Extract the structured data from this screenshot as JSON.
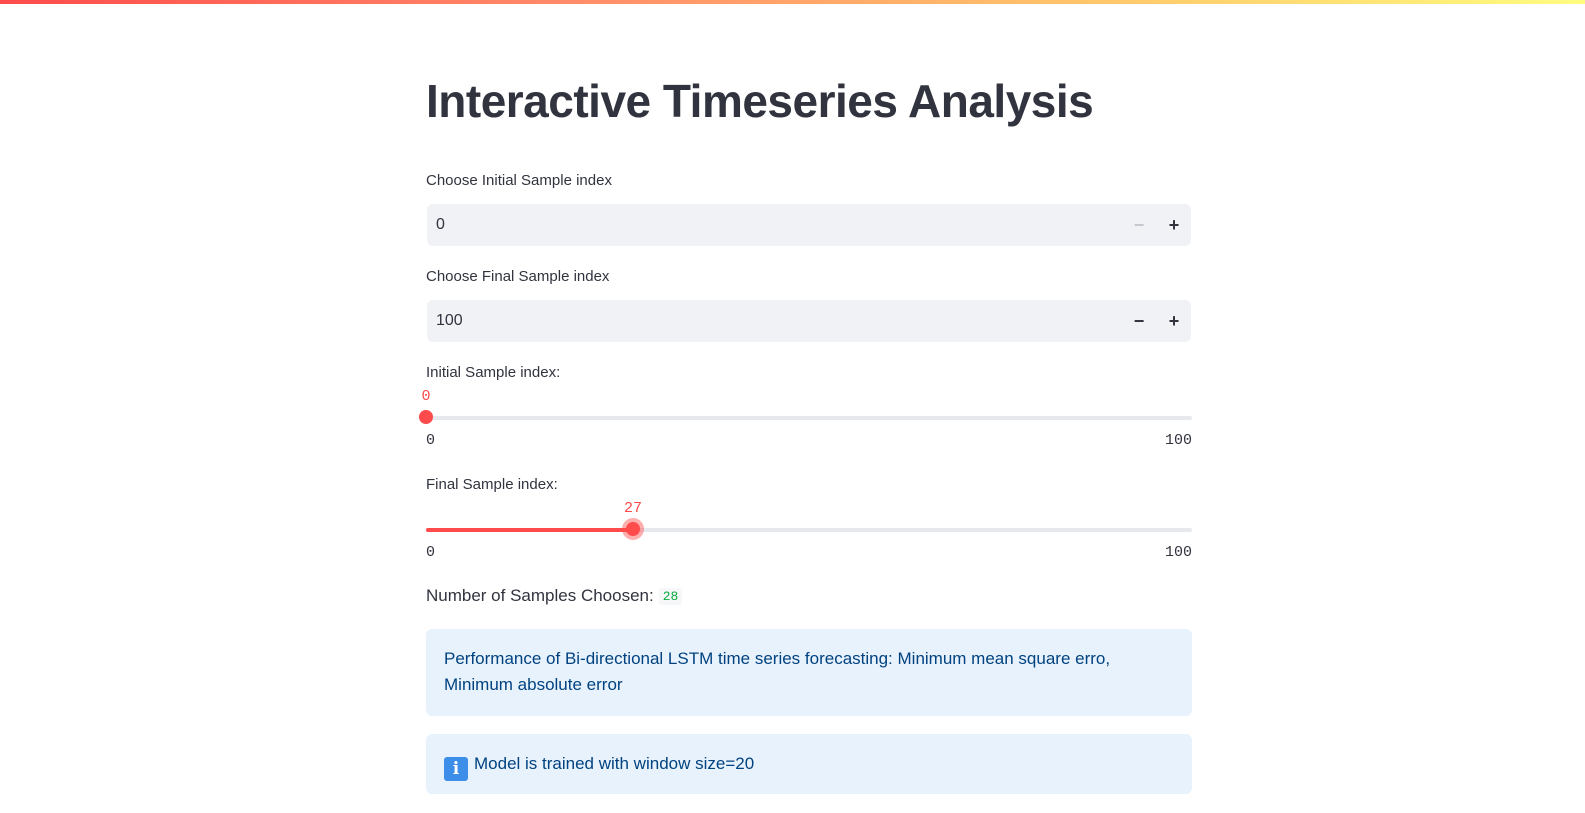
{
  "page": {
    "title": "Interactive Timeseries Analysis"
  },
  "initial_input": {
    "label": "Choose Initial Sample index",
    "value": "0",
    "minus_label": "−",
    "plus_label": "+",
    "minus_disabled": true
  },
  "final_input": {
    "label": "Choose Final Sample index",
    "value": "100",
    "minus_label": "−",
    "plus_label": "+",
    "minus_disabled": false
  },
  "initial_slider": {
    "label": "Initial Sample index:",
    "value": 0,
    "value_text": "0",
    "min": 0,
    "max": 100,
    "min_text": "0",
    "max_text": "100"
  },
  "final_slider": {
    "label": "Final Sample index:",
    "value": 27,
    "value_text": "27",
    "min": 0,
    "max": 100,
    "min_text": "0",
    "max_text": "100"
  },
  "summary": {
    "label": "Number of Samples Choosen:",
    "value": "28"
  },
  "info_performance": {
    "text": "Performance of Bi-directional LSTM time series forecasting: Minimum mean square erro, Minimum absolute error"
  },
  "info_model": {
    "icon": "information-icon",
    "icon_glyph": "i",
    "text": "Model is trained with window size=20"
  },
  "colors": {
    "accent": "#ff4b4b",
    "info_background": "#e8f2fc",
    "info_text": "#004280",
    "code_green": "#09ab3b",
    "input_background": "#f0f2f6"
  }
}
